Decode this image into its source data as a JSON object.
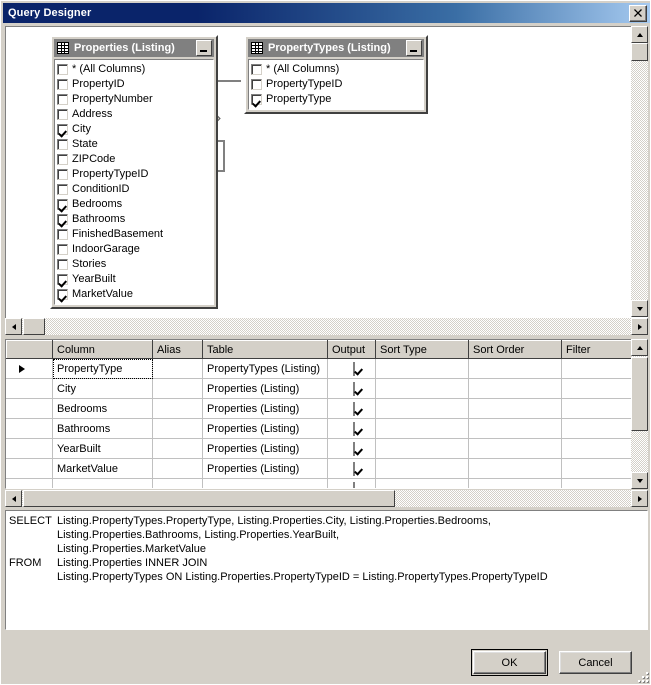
{
  "window": {
    "title": "Query Designer",
    "close_label": "✕"
  },
  "diagram": {
    "tables": [
      {
        "title": "Properties (Listing)",
        "icon": "table-grid-icon",
        "minimize_label": "_",
        "fields": [
          {
            "name": "* (All Columns)",
            "checked": false
          },
          {
            "name": "PropertyID",
            "checked": false
          },
          {
            "name": "PropertyNumber",
            "checked": false
          },
          {
            "name": "Address",
            "checked": false
          },
          {
            "name": "City",
            "checked": true
          },
          {
            "name": "State",
            "checked": false
          },
          {
            "name": "ZIPCode",
            "checked": false
          },
          {
            "name": "PropertyTypeID",
            "checked": false
          },
          {
            "name": "ConditionID",
            "checked": false
          },
          {
            "name": "Bedrooms",
            "checked": true
          },
          {
            "name": "Bathrooms",
            "checked": true
          },
          {
            "name": "FinishedBasement",
            "checked": false
          },
          {
            "name": "IndoorGarage",
            "checked": false
          },
          {
            "name": "Stories",
            "checked": false
          },
          {
            "name": "YearBuilt",
            "checked": true
          },
          {
            "name": "MarketValue",
            "checked": true
          }
        ]
      },
      {
        "title": "PropertyTypes (Listing)",
        "icon": "table-grid-icon",
        "minimize_label": "_",
        "fields": [
          {
            "name": "* (All Columns)",
            "checked": false
          },
          {
            "name": "PropertyTypeID",
            "checked": false
          },
          {
            "name": "PropertyType",
            "checked": true
          }
        ]
      }
    ],
    "join": {
      "type": "inner-join",
      "left_table": "Properties (Listing)",
      "left_field": "PropertyTypeID",
      "right_table": "PropertyTypes (Listing)",
      "right_field": "PropertyTypeID"
    }
  },
  "grid": {
    "columns": [
      "Column",
      "Alias",
      "Table",
      "Output",
      "Sort Type",
      "Sort Order",
      "Filter"
    ],
    "rows": [
      {
        "column": "PropertyType",
        "alias": "",
        "table": "PropertyTypes (Listing)",
        "output": true,
        "sort_type": "",
        "sort_order": "",
        "filter": "",
        "selected": true
      },
      {
        "column": "City",
        "alias": "",
        "table": "Properties (Listing)",
        "output": true,
        "sort_type": "",
        "sort_order": "",
        "filter": "",
        "selected": false
      },
      {
        "column": "Bedrooms",
        "alias": "",
        "table": "Properties (Listing)",
        "output": true,
        "sort_type": "",
        "sort_order": "",
        "filter": "",
        "selected": false
      },
      {
        "column": "Bathrooms",
        "alias": "",
        "table": "Properties (Listing)",
        "output": true,
        "sort_type": "",
        "sort_order": "",
        "filter": "",
        "selected": false
      },
      {
        "column": "YearBuilt",
        "alias": "",
        "table": "Properties (Listing)",
        "output": true,
        "sort_type": "",
        "sort_order": "",
        "filter": "",
        "selected": false
      },
      {
        "column": "MarketValue",
        "alias": "",
        "table": "Properties (Listing)",
        "output": true,
        "sort_type": "",
        "sort_order": "",
        "filter": "",
        "selected": false
      },
      {
        "column": "",
        "alias": "",
        "table": "",
        "output": "disabled",
        "sort_type": "",
        "sort_order": "",
        "filter": "",
        "selected": false
      }
    ]
  },
  "sql": {
    "lines": [
      {
        "keyword": "SELECT",
        "text": "Listing.PropertyTypes.PropertyType, Listing.Properties.City, Listing.Properties.Bedrooms,"
      },
      {
        "keyword": "",
        "text": "Listing.Properties.Bathrooms, Listing.Properties.YearBuilt,"
      },
      {
        "keyword": "",
        "text": "Listing.Properties.MarketValue"
      },
      {
        "keyword": "FROM",
        "text": "Listing.Properties INNER JOIN"
      },
      {
        "keyword": "",
        "text": "Listing.PropertyTypes ON Listing.Properties.PropertyTypeID = Listing.PropertyTypes.PropertyTypeID"
      }
    ]
  },
  "footer": {
    "ok_label": "OK",
    "cancel_label": "Cancel"
  },
  "scrollbars": {
    "up_arrow": "▲",
    "down_arrow": "▼",
    "left_arrow": "◀",
    "right_arrow": "▶"
  },
  "colors": {
    "title_start": "#0a246a",
    "title_end": "#a6caf0",
    "face": "#d4d0c8",
    "panel_header": "#808080",
    "selected_cell": "#c8c4bc"
  }
}
